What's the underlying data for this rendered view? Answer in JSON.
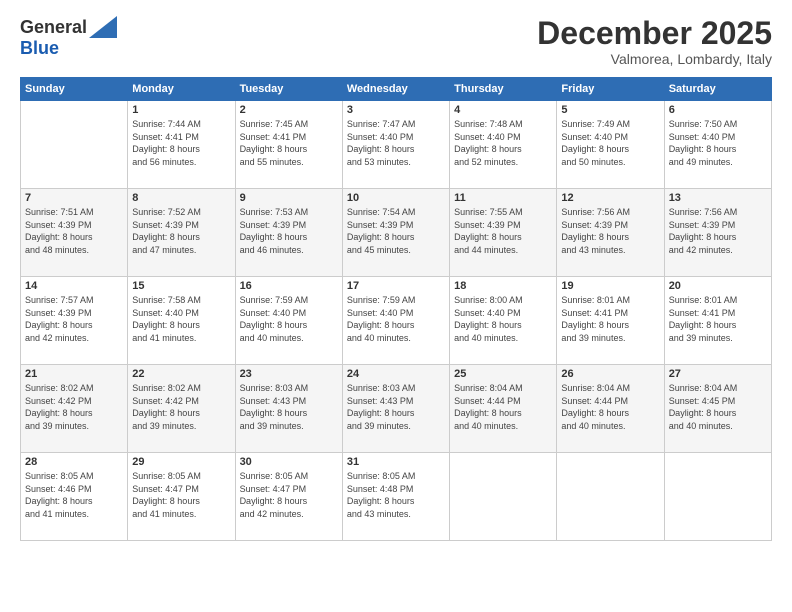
{
  "logo": {
    "general": "General",
    "blue": "Blue"
  },
  "title": "December 2025",
  "location": "Valmorea, Lombardy, Italy",
  "headers": [
    "Sunday",
    "Monday",
    "Tuesday",
    "Wednesday",
    "Thursday",
    "Friday",
    "Saturday"
  ],
  "weeks": [
    [
      {
        "day": "",
        "sunrise": "",
        "sunset": "",
        "daylight": ""
      },
      {
        "day": "1",
        "sunrise": "Sunrise: 7:44 AM",
        "sunset": "Sunset: 4:41 PM",
        "daylight": "Daylight: 8 hours and 56 minutes."
      },
      {
        "day": "2",
        "sunrise": "Sunrise: 7:45 AM",
        "sunset": "Sunset: 4:41 PM",
        "daylight": "Daylight: 8 hours and 55 minutes."
      },
      {
        "day": "3",
        "sunrise": "Sunrise: 7:47 AM",
        "sunset": "Sunset: 4:40 PM",
        "daylight": "Daylight: 8 hours and 53 minutes."
      },
      {
        "day": "4",
        "sunrise": "Sunrise: 7:48 AM",
        "sunset": "Sunset: 4:40 PM",
        "daylight": "Daylight: 8 hours and 52 minutes."
      },
      {
        "day": "5",
        "sunrise": "Sunrise: 7:49 AM",
        "sunset": "Sunset: 4:40 PM",
        "daylight": "Daylight: 8 hours and 50 minutes."
      },
      {
        "day": "6",
        "sunrise": "Sunrise: 7:50 AM",
        "sunset": "Sunset: 4:40 PM",
        "daylight": "Daylight: 8 hours and 49 minutes."
      }
    ],
    [
      {
        "day": "7",
        "sunrise": "Sunrise: 7:51 AM",
        "sunset": "Sunset: 4:39 PM",
        "daylight": "Daylight: 8 hours and 48 minutes."
      },
      {
        "day": "8",
        "sunrise": "Sunrise: 7:52 AM",
        "sunset": "Sunset: 4:39 PM",
        "daylight": "Daylight: 8 hours and 47 minutes."
      },
      {
        "day": "9",
        "sunrise": "Sunrise: 7:53 AM",
        "sunset": "Sunset: 4:39 PM",
        "daylight": "Daylight: 8 hours and 46 minutes."
      },
      {
        "day": "10",
        "sunrise": "Sunrise: 7:54 AM",
        "sunset": "Sunset: 4:39 PM",
        "daylight": "Daylight: 8 hours and 45 minutes."
      },
      {
        "day": "11",
        "sunrise": "Sunrise: 7:55 AM",
        "sunset": "Sunset: 4:39 PM",
        "daylight": "Daylight: 8 hours and 44 minutes."
      },
      {
        "day": "12",
        "sunrise": "Sunrise: 7:56 AM",
        "sunset": "Sunset: 4:39 PM",
        "daylight": "Daylight: 8 hours and 43 minutes."
      },
      {
        "day": "13",
        "sunrise": "Sunrise: 7:56 AM",
        "sunset": "Sunset: 4:39 PM",
        "daylight": "Daylight: 8 hours and 42 minutes."
      }
    ],
    [
      {
        "day": "14",
        "sunrise": "Sunrise: 7:57 AM",
        "sunset": "Sunset: 4:39 PM",
        "daylight": "Daylight: 8 hours and 42 minutes."
      },
      {
        "day": "15",
        "sunrise": "Sunrise: 7:58 AM",
        "sunset": "Sunset: 4:40 PM",
        "daylight": "Daylight: 8 hours and 41 minutes."
      },
      {
        "day": "16",
        "sunrise": "Sunrise: 7:59 AM",
        "sunset": "Sunset: 4:40 PM",
        "daylight": "Daylight: 8 hours and 40 minutes."
      },
      {
        "day": "17",
        "sunrise": "Sunrise: 7:59 AM",
        "sunset": "Sunset: 4:40 PM",
        "daylight": "Daylight: 8 hours and 40 minutes."
      },
      {
        "day": "18",
        "sunrise": "Sunrise: 8:00 AM",
        "sunset": "Sunset: 4:40 PM",
        "daylight": "Daylight: 8 hours and 40 minutes."
      },
      {
        "day": "19",
        "sunrise": "Sunrise: 8:01 AM",
        "sunset": "Sunset: 4:41 PM",
        "daylight": "Daylight: 8 hours and 39 minutes."
      },
      {
        "day": "20",
        "sunrise": "Sunrise: 8:01 AM",
        "sunset": "Sunset: 4:41 PM",
        "daylight": "Daylight: 8 hours and 39 minutes."
      }
    ],
    [
      {
        "day": "21",
        "sunrise": "Sunrise: 8:02 AM",
        "sunset": "Sunset: 4:42 PM",
        "daylight": "Daylight: 8 hours and 39 minutes."
      },
      {
        "day": "22",
        "sunrise": "Sunrise: 8:02 AM",
        "sunset": "Sunset: 4:42 PM",
        "daylight": "Daylight: 8 hours and 39 minutes."
      },
      {
        "day": "23",
        "sunrise": "Sunrise: 8:03 AM",
        "sunset": "Sunset: 4:43 PM",
        "daylight": "Daylight: 8 hours and 39 minutes."
      },
      {
        "day": "24",
        "sunrise": "Sunrise: 8:03 AM",
        "sunset": "Sunset: 4:43 PM",
        "daylight": "Daylight: 8 hours and 39 minutes."
      },
      {
        "day": "25",
        "sunrise": "Sunrise: 8:04 AM",
        "sunset": "Sunset: 4:44 PM",
        "daylight": "Daylight: 8 hours and 40 minutes."
      },
      {
        "day": "26",
        "sunrise": "Sunrise: 8:04 AM",
        "sunset": "Sunset: 4:44 PM",
        "daylight": "Daylight: 8 hours and 40 minutes."
      },
      {
        "day": "27",
        "sunrise": "Sunrise: 8:04 AM",
        "sunset": "Sunset: 4:45 PM",
        "daylight": "Daylight: 8 hours and 40 minutes."
      }
    ],
    [
      {
        "day": "28",
        "sunrise": "Sunrise: 8:05 AM",
        "sunset": "Sunset: 4:46 PM",
        "daylight": "Daylight: 8 hours and 41 minutes."
      },
      {
        "day": "29",
        "sunrise": "Sunrise: 8:05 AM",
        "sunset": "Sunset: 4:47 PM",
        "daylight": "Daylight: 8 hours and 41 minutes."
      },
      {
        "day": "30",
        "sunrise": "Sunrise: 8:05 AM",
        "sunset": "Sunset: 4:47 PM",
        "daylight": "Daylight: 8 hours and 42 minutes."
      },
      {
        "day": "31",
        "sunrise": "Sunrise: 8:05 AM",
        "sunset": "Sunset: 4:48 PM",
        "daylight": "Daylight: 8 hours and 43 minutes."
      },
      {
        "day": "",
        "sunrise": "",
        "sunset": "",
        "daylight": ""
      },
      {
        "day": "",
        "sunrise": "",
        "sunset": "",
        "daylight": ""
      },
      {
        "day": "",
        "sunrise": "",
        "sunset": "",
        "daylight": ""
      }
    ]
  ]
}
